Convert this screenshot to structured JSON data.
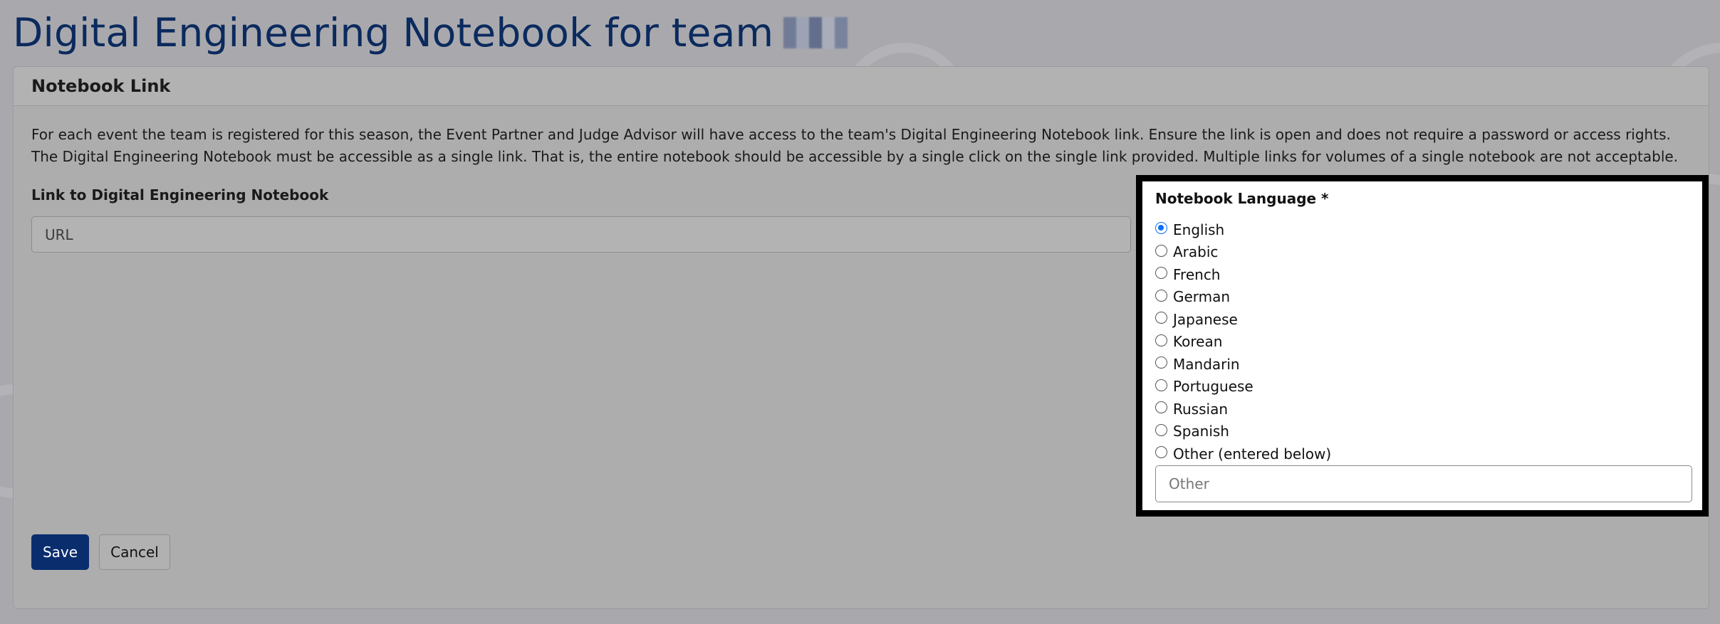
{
  "page": {
    "title": "Digital Engineering Notebook for team"
  },
  "card": {
    "header": "Notebook Link",
    "intro_line1": "For each event the team is registered for this season, the Event Partner and Judge Advisor will have access to the team's Digital Engineering Notebook link. Ensure the link is open and does not require a password or access rights.",
    "intro_line2": "The Digital Engineering Notebook must be accessible as a single link. That is, the entire notebook should be accessible by a single click on the single link provided. Multiple links for volumes of a single notebook are not acceptable."
  },
  "link_field": {
    "label": "Link to Digital Engineering Notebook",
    "placeholder": "URL",
    "value": ""
  },
  "language": {
    "label": "Notebook Language *",
    "selected": "English",
    "options": [
      "English",
      "Arabic",
      "French",
      "German",
      "Japanese",
      "Korean",
      "Mandarin",
      "Portuguese",
      "Russian",
      "Spanish",
      "Other (entered below)"
    ],
    "other_placeholder": "Other"
  },
  "actions": {
    "save_label": "Save",
    "cancel_label": "Cancel"
  },
  "colors": {
    "title": "#0b2a5e",
    "primary_button": "#0a2d6e",
    "radio_accent": "#0d6efd",
    "highlight_border": "#000000"
  }
}
